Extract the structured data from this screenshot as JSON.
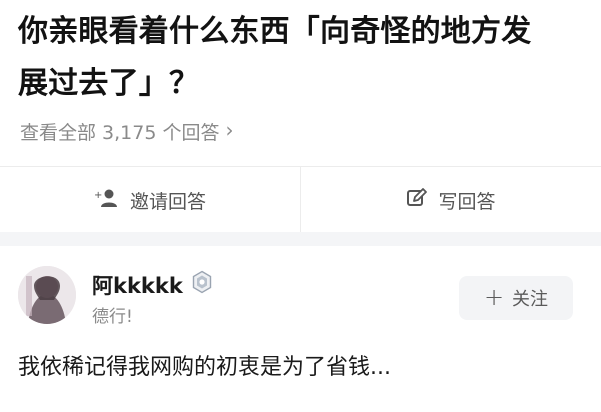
{
  "question": {
    "title_line1": "你亲眼看着什么东西「向奇怪的地方发",
    "title_line2": "展过去了」？"
  },
  "answers_link": {
    "label": "查看全部 3,175 个回答",
    "chevron": "›"
  },
  "actions": {
    "invite_label": "邀请回答",
    "write_label": "写回答"
  },
  "answer": {
    "author_name": "阿kkkkk",
    "author_bio": "德行!",
    "follow_label": "关注",
    "follow_plus": "+",
    "excerpt": "我依稀记得我网购的初衷是为了省钱..."
  },
  "icons": {
    "invite": "add-user-icon",
    "write": "edit-icon",
    "badge": "verified-badge-icon",
    "chevron": "chevron-right-icon"
  },
  "colors": {
    "text_primary": "#121212",
    "text_secondary": "#8a8a8a",
    "divider": "#ececec",
    "band": "#f4f5f7",
    "button_bg": "#f3f4f6"
  }
}
